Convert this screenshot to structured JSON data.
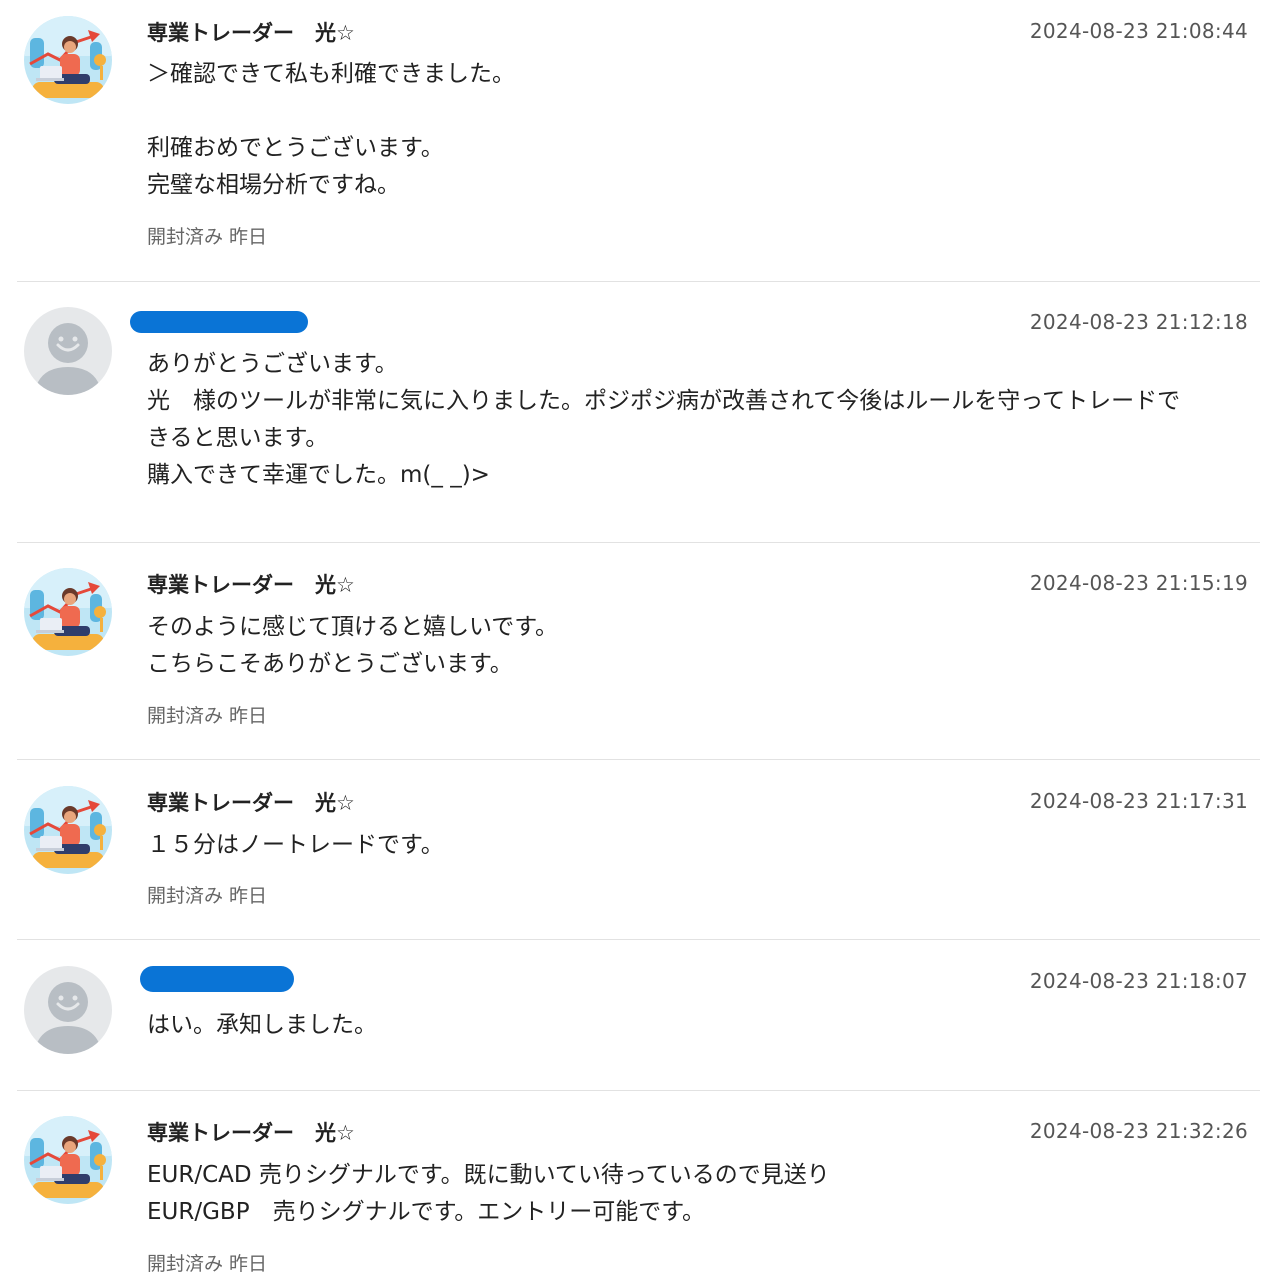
{
  "messages": [
    {
      "sender": "専業トレーダー　光☆",
      "avatar": "trader-avatar",
      "timestamp": "2024-08-23 21:08:44",
      "lines": [
        "＞確認できて私も利確できました。",
        "",
        "利確おめでとうございます。",
        "完璧な相場分析ですね。"
      ],
      "status": "開封済み 昨日"
    },
    {
      "sender": "",
      "sender_redacted": true,
      "avatar": "default-user-avatar",
      "timestamp": "2024-08-23 21:12:18",
      "lines": [
        "ありがとうございます。",
        "光　様のツールが非常に気に入りました。ポジポジ病が改善されて今後はルールを守ってトレードで",
        "きると思います。",
        "購入できて幸運でした。m(_ _)>"
      ],
      "status": ""
    },
    {
      "sender": "専業トレーダー　光☆",
      "avatar": "trader-avatar",
      "timestamp": "2024-08-23 21:15:19",
      "lines": [
        "そのように感じて頂けると嬉しいです。",
        "こちらこそありがとうございます。"
      ],
      "status": "開封済み 昨日"
    },
    {
      "sender": "専業トレーダー　光☆",
      "avatar": "trader-avatar",
      "timestamp": "2024-08-23 21:17:31",
      "lines": [
        "１５分はノートレードです。"
      ],
      "status": "開封済み 昨日"
    },
    {
      "sender": "",
      "sender_redacted": true,
      "avatar": "default-user-avatar",
      "timestamp": "2024-08-23 21:18:07",
      "lines": [
        "はい。承知しました。"
      ],
      "status": ""
    },
    {
      "sender": "専業トレーダー　光☆",
      "avatar": "trader-avatar",
      "timestamp": "2024-08-23 21:32:26",
      "lines": [
        "EUR/CAD 売りシグナルです。既に動いてい待っているので見送り",
        "EUR/GBP　売りシグナルです。エントリー可能です。"
      ],
      "status": "開封済み 昨日"
    }
  ],
  "colors": {
    "redaction": "#0a74d6",
    "divider": "#e2e2e2",
    "timestamp": "#555555",
    "status": "#666666",
    "default_avatar_bg": "#e6e8ea",
    "default_avatar_fg": "#b8bec4"
  }
}
